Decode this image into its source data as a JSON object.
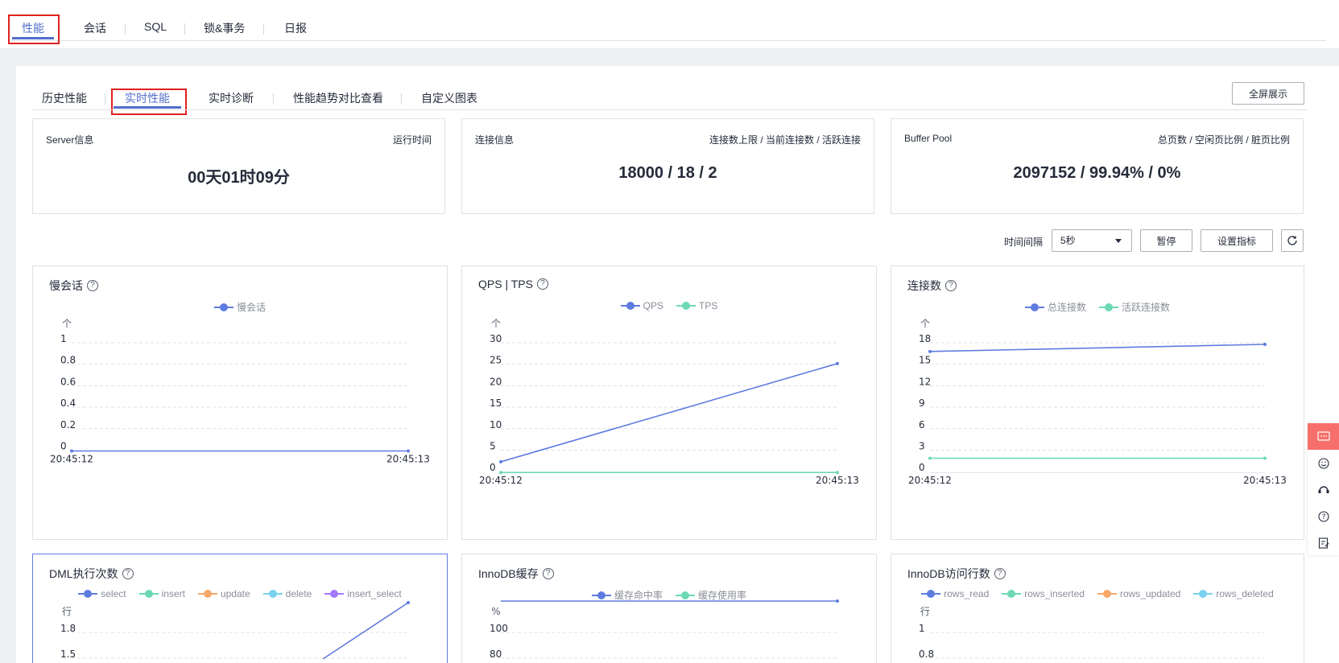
{
  "top_tabs": [
    "性能",
    "会话",
    "SQL",
    "锁&事务",
    "日报"
  ],
  "sub_tabs": [
    "历史性能",
    "实时性能",
    "实时诊断",
    "性能趋势对比查看",
    "自定义图表"
  ],
  "fullscreen_label": "全屏展示",
  "info_cards": [
    {
      "label": "Server信息",
      "right_label": "运行时间",
      "value": "00天01时09分"
    },
    {
      "label": "连接信息",
      "right_label": "连接数上限 / 当前连接数 / 活跃连接",
      "value": "18000 / 18 / 2"
    },
    {
      "label": "Buffer Pool",
      "right_label": "总页数 / 空闲页比例 / 脏页比例",
      "value": "2097152 / 99.94% / 0%"
    }
  ],
  "controls": {
    "interval_label": "时间间隔",
    "interval_value": "5秒",
    "pause_label": "暂停",
    "set_metrics_label": "设置指标"
  },
  "colors": {
    "accent": "#526ecc",
    "blue": "#5e7ce0",
    "green": "#6cd9b4",
    "orange": "#f8a766",
    "cyan": "#79d2ee",
    "purple": "#a379ff"
  },
  "charts": [
    {
      "title": "慢会话",
      "unit": "个",
      "x": [
        "20:45:12",
        "20:45:13"
      ],
      "yticks": [
        "0",
        "0.2",
        "0.4",
        "0.6",
        "0.8",
        "1"
      ],
      "ylim": [
        0,
        1
      ],
      "series": [
        {
          "name": "慢会话",
          "color": "#5e7ce0",
          "values": [
            0,
            0
          ]
        }
      ]
    },
    {
      "title": "QPS | TPS",
      "unit": "个",
      "x": [
        "20:45:12",
        "20:45:13"
      ],
      "yticks": [
        "0",
        "5",
        "10",
        "15",
        "20",
        "25",
        "30"
      ],
      "ylim": [
        0,
        30
      ],
      "series": [
        {
          "name": "QPS",
          "color": "#5e7ce0",
          "values": [
            2.5,
            25.5
          ]
        },
        {
          "name": "TPS",
          "color": "#6cd9b4",
          "values": [
            0,
            0
          ]
        }
      ]
    },
    {
      "title": "连接数",
      "unit": "个",
      "x": [
        "20:45:12",
        "20:45:13"
      ],
      "yticks": [
        "0",
        "3",
        "6",
        "9",
        "12",
        "15",
        "18"
      ],
      "ylim": [
        0,
        18
      ],
      "series": [
        {
          "name": "总连接数",
          "color": "#5e7ce0",
          "values": [
            17,
            18
          ]
        },
        {
          "name": "活跃连接数",
          "color": "#6cd9b4",
          "values": [
            2,
            2
          ]
        }
      ]
    },
    {
      "title": "DML执行次数",
      "unit": "行",
      "x": [],
      "yticks": [
        "1.5",
        "1.8"
      ],
      "ylim": [
        0,
        1.8
      ],
      "series": [
        {
          "name": "select",
          "color": "#5e7ce0",
          "values": [
            0,
            1.8
          ]
        },
        {
          "name": "insert",
          "color": "#6cd9b4",
          "values": []
        },
        {
          "name": "update",
          "color": "#f8a766",
          "values": []
        },
        {
          "name": "delete",
          "color": "#79d2ee",
          "values": []
        },
        {
          "name": "insert_select",
          "color": "#a379ff",
          "values": []
        }
      ]
    },
    {
      "title": "InnoDB缓存",
      "unit": "%",
      "x": [],
      "yticks": [
        "80",
        "100"
      ],
      "ylim": [
        0,
        100
      ],
      "series": [
        {
          "name": "缓存命中率",
          "color": "#5e7ce0",
          "values": [
            100,
            100
          ]
        },
        {
          "name": "缓存使用率",
          "color": "#6cd9b4",
          "values": []
        }
      ]
    },
    {
      "title": "InnoDB访问行数",
      "unit": "行",
      "x": [],
      "yticks": [
        "0.8",
        "1"
      ],
      "ylim": [
        0,
        1
      ],
      "series": [
        {
          "name": "rows_read",
          "color": "#5e7ce0",
          "values": []
        },
        {
          "name": "rows_inserted",
          "color": "#6cd9b4",
          "values": []
        },
        {
          "name": "rows_updated",
          "color": "#f8a766",
          "values": []
        },
        {
          "name": "rows_deleted",
          "color": "#79d2ee",
          "values": []
        }
      ]
    }
  ],
  "chart_data": [
    {
      "type": "line",
      "title": "慢会话",
      "ylabel": "个",
      "x": [
        "20:45:12",
        "20:45:13"
      ],
      "series": [
        {
          "name": "慢会话",
          "values": [
            0,
            0
          ]
        }
      ],
      "ylim": [
        0,
        1
      ]
    },
    {
      "type": "line",
      "title": "QPS | TPS",
      "ylabel": "个",
      "x": [
        "20:45:12",
        "20:45:13"
      ],
      "series": [
        {
          "name": "QPS",
          "values": [
            2.5,
            25.5
          ]
        },
        {
          "name": "TPS",
          "values": [
            0,
            0
          ]
        }
      ],
      "ylim": [
        0,
        30
      ]
    },
    {
      "type": "line",
      "title": "连接数",
      "ylabel": "个",
      "x": [
        "20:45:12",
        "20:45:13"
      ],
      "series": [
        {
          "name": "总连接数",
          "values": [
            17,
            18
          ]
        },
        {
          "name": "活跃连接数",
          "values": [
            2,
            2
          ]
        }
      ],
      "ylim": [
        0,
        18
      ]
    }
  ],
  "right_toolbar": [
    "message-icon",
    "smile-icon",
    "headset-icon",
    "help-icon",
    "edit-note-icon"
  ]
}
